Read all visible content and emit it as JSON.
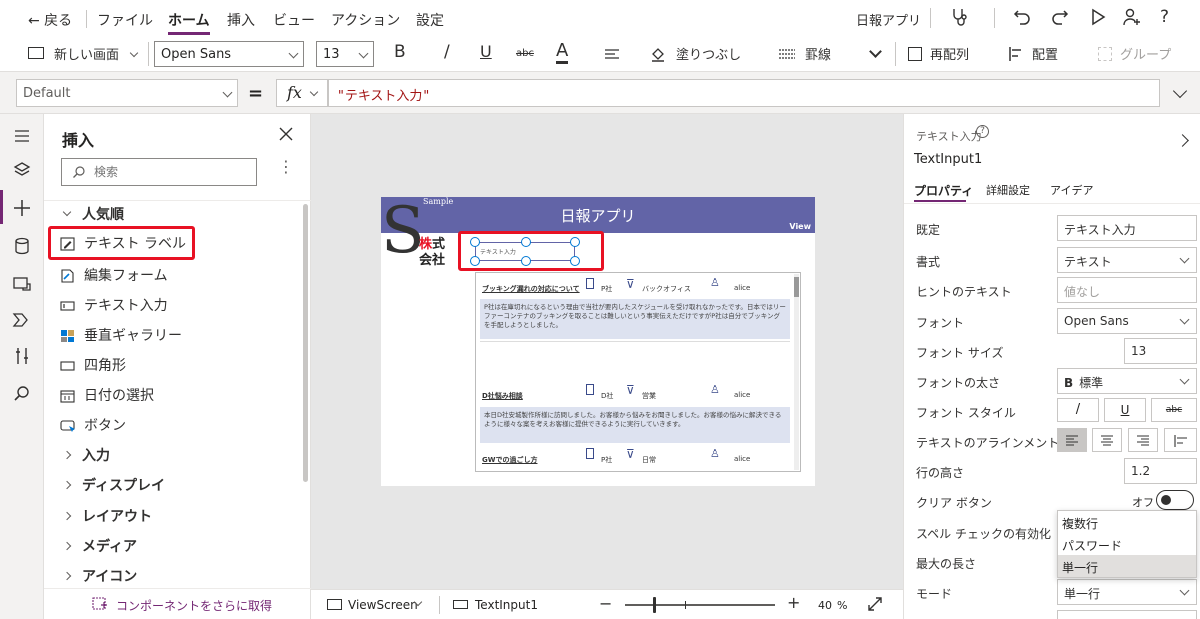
{
  "menu": {
    "back": "← 戻る",
    "file": "ファイル",
    "home": "ホーム",
    "insert": "挿入",
    "view": "ビュー",
    "action": "アクション",
    "settings": "設定",
    "app_name": "日報アプリ"
  },
  "toolbar": {
    "new_screen": "新しい画面",
    "font": "Open Sans",
    "font_size": "13",
    "bold": "B",
    "italic": "/",
    "underline": "U",
    "strike": "abc",
    "font_color": "A",
    "fill": "塗りつぶし",
    "border": "罫線",
    "reorder": "再配列",
    "align": "配置",
    "group": "グループ"
  },
  "formula": {
    "property": "Default",
    "equals": "=",
    "fx": "fx",
    "value": "\"テキスト入力\""
  },
  "insert_pane": {
    "title": "挿入",
    "search_placeholder": "検索",
    "popular": "人気順",
    "items": [
      "テキスト ラベル",
      "編集フォーム",
      "テキスト入力",
      "垂直ギャラリー",
      "四角形",
      "日付の選択",
      "ボタン"
    ],
    "categories": [
      "入力",
      "ディスプレイ",
      "レイアウト",
      "メディア",
      "アイコン"
    ],
    "get_more": "コンポーネントをさらに取得"
  },
  "app": {
    "title": "日報アプリ",
    "view": "View",
    "logo_sample": "Sample",
    "logo_line1": "株式",
    "logo_line2": "会社",
    "textinput_value": "テキスト入力",
    "gallery": [
      {
        "title": "ブッキング漏れの対応について",
        "company": "P社",
        "dept": "バックオフィス",
        "user": "alice",
        "body": "P社は在庫切れになるという理由で当社が要内したスケジュールを受け取れなかったです。日本ではリーファーコンテナのブッキングを取ることは難しいという事実伝えただけですがP社は自分でブッキングを手配しようとしました。"
      },
      {
        "title": "D社悩み相談",
        "company": "D社",
        "dept": "営業",
        "user": "alice",
        "body": "本日D社安城製作所様に訪問しました。お客様から悩みをお聞きしました。お客様の悩みに解決できるように様々な案を考えお客様に提供できるように実行していきます。"
      },
      {
        "title": "GWでの過ごし方",
        "company": "P社",
        "dept": "日常",
        "user": "alice",
        "body": ""
      }
    ]
  },
  "bottom": {
    "screen": "ViewScreen",
    "control": "TextInput1",
    "zoom": "40",
    "zoom_unit": "%"
  },
  "right_pane": {
    "type_label": "テキスト入力",
    "control_name": "TextInput1",
    "tabs": [
      "プロパティ",
      "詳細設定",
      "アイデア"
    ],
    "props": [
      {
        "label": "既定",
        "value": "テキスト入力"
      },
      {
        "label": "書式",
        "value": "テキスト"
      },
      {
        "label": "ヒントのテキスト",
        "value": "値なし"
      },
      {
        "label": "フォント",
        "value": "Open Sans"
      },
      {
        "label": "フォント サイズ",
        "value": "13"
      },
      {
        "label": "フォントの太さ",
        "value": "標準"
      },
      {
        "label": "フォント スタイル",
        "value": ""
      },
      {
        "label": "テキストのアラインメント",
        "value": ""
      },
      {
        "label": "行の高さ",
        "value": "1.2"
      },
      {
        "label": "クリア ボタン",
        "value": "オフ"
      },
      {
        "label": "スペル チェックの有効化",
        "value": ""
      },
      {
        "label": "最大の長さ",
        "value": ""
      },
      {
        "label": "モード",
        "value": "単一行"
      }
    ],
    "font_weight_prefix": "B",
    "mode_options": [
      "複数行",
      "パスワード",
      "単一行"
    ]
  },
  "colors": {
    "accent": "#742774",
    "header": "#6264a7",
    "highlight": "#e81123",
    "gallery_row": "#dde2f0"
  }
}
